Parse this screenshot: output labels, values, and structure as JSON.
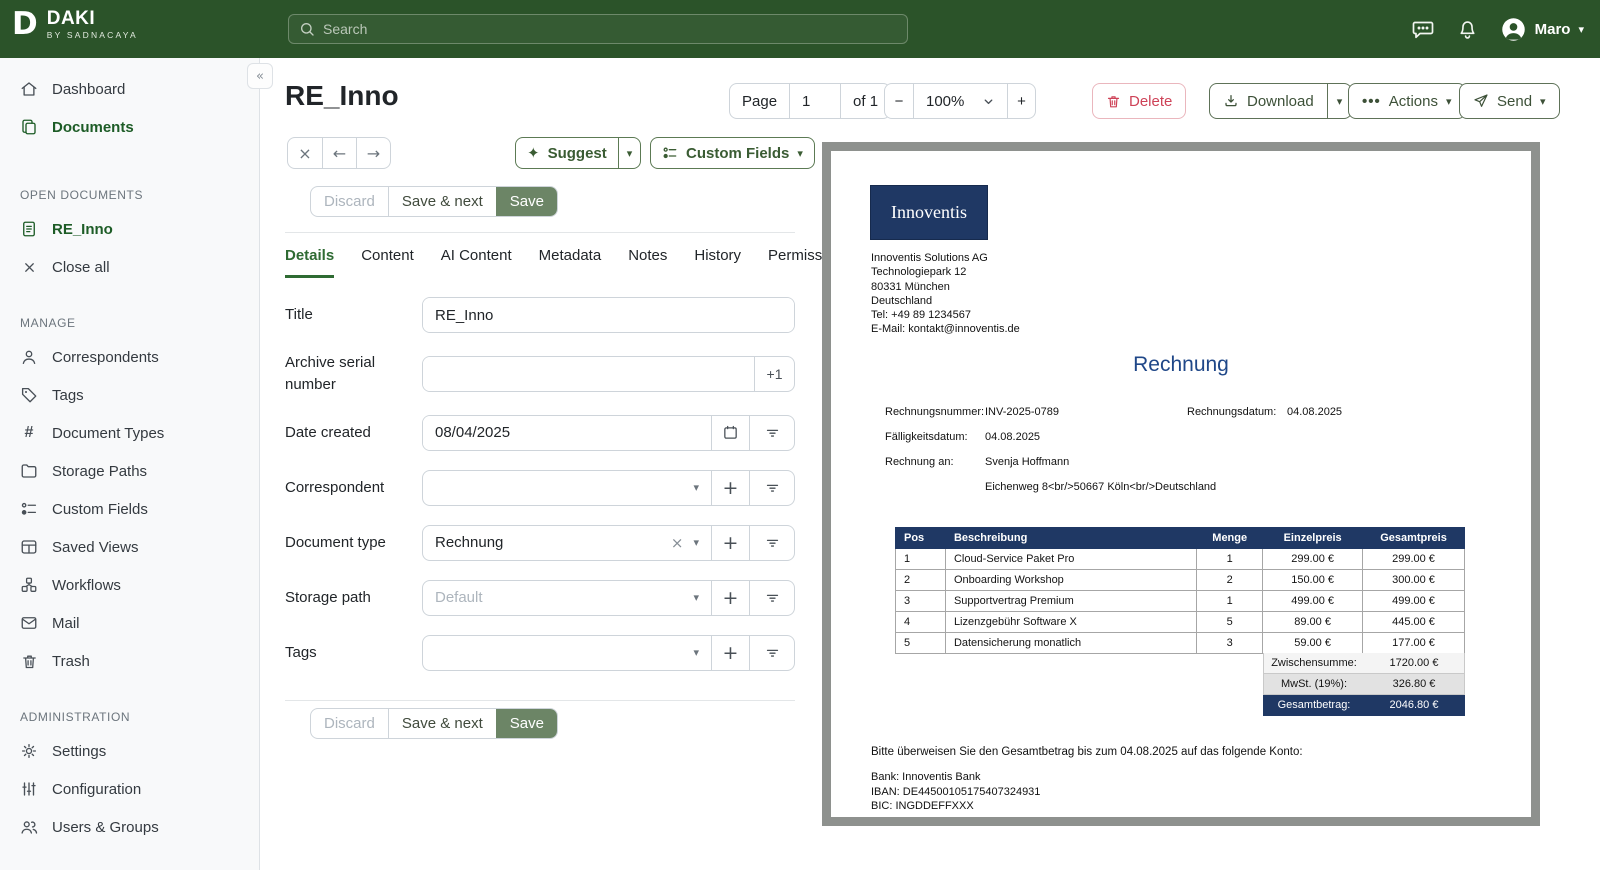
{
  "colors": {
    "header_green": "#2b5329",
    "accent_green": "#1d5c26",
    "button_green": "#3d5138",
    "save_fill_green": "#6c8566",
    "delete_red": "#ce4257",
    "invoice_navy": "#1f3864",
    "invoice_blue": "#1f4788"
  },
  "icons": {
    "collapse": "«",
    "close": "×",
    "arrow_left": "←",
    "arrow_right": "→",
    "sparkle": "✦",
    "ellipsis": "•••",
    "plus": "+",
    "minus": "−",
    "caret": "▾",
    "clear": "×"
  },
  "header": {
    "brand": "DAKI",
    "brand_sub": "BY SADNACAYA",
    "search_placeholder": "Search",
    "user_name": "Maro"
  },
  "sidebar": {
    "dashboard": "Dashboard",
    "documents": "Documents",
    "open_documents_header": "OPEN DOCUMENTS",
    "open_doc_name": "RE_Inno",
    "close_all": "Close all",
    "manage_header": "MANAGE",
    "manage": [
      "Correspondents",
      "Tags",
      "Document Types",
      "Storage Paths",
      "Custom Fields",
      "Saved Views",
      "Workflows",
      "Mail",
      "Trash"
    ],
    "admin_header": "ADMINISTRATION",
    "admin": [
      "Settings",
      "Configuration",
      "Users & Groups"
    ]
  },
  "toolbar": {
    "title": "RE_Inno",
    "page_label": "Page",
    "page_value": "1",
    "page_of": "of 1",
    "zoom_value": "100%",
    "delete": "Delete",
    "download": "Download",
    "actions": "Actions",
    "send": "Send"
  },
  "editor": {
    "suggest": "Suggest",
    "custom_fields": "Custom Fields",
    "discard": "Discard",
    "save_next": "Save & next",
    "save": "Save",
    "tabs": [
      "Details",
      "Content",
      "AI Content",
      "Metadata",
      "Notes",
      "History",
      "Permissions"
    ],
    "fields": {
      "title": {
        "label": "Title",
        "value": "RE_Inno"
      },
      "asn": {
        "label": "Archive serial number",
        "value": "",
        "increment": "+1"
      },
      "date_created": {
        "label": "Date created",
        "value": "08/04/2025"
      },
      "correspondent": {
        "label": "Correspondent",
        "value": ""
      },
      "document_type": {
        "label": "Document type",
        "value": "Rechnung"
      },
      "storage_path": {
        "label": "Storage path",
        "placeholder": "Default"
      },
      "tags": {
        "label": "Tags",
        "value": ""
      }
    }
  },
  "invoice": {
    "logo_text": "Innoventis",
    "company_lines": [
      "Innoventis Solutions AG",
      "Technologiepark 12",
      "80331 München",
      "Deutschland",
      "Tel: +49 89 1234567",
      "E-Mail: kontakt@innoventis.de"
    ],
    "title": "Rechnung",
    "meta": {
      "invoice_no_label": "Rechnungsnummer:",
      "invoice_no": "INV-2025-0789",
      "invoice_date_label": "Rechnungsdatum:",
      "invoice_date": "04.08.2025",
      "due_date_label": "Fälligkeitsdatum:",
      "due_date": "04.08.2025",
      "bill_to_label": "Rechnung an:",
      "bill_to_name": "Svenja Hoffmann",
      "bill_to_address": "Eichenweg 8<br/>50667 Köln<br/>Deutschland"
    },
    "table": {
      "headers": [
        "Pos",
        "Beschreibung",
        "Menge",
        "Einzelpreis",
        "Gesamtpreis"
      ],
      "rows": [
        [
          "1",
          "Cloud-Service Paket Pro",
          "1",
          "299.00 €",
          "299.00 €"
        ],
        [
          "2",
          "Onboarding Workshop",
          "2",
          "150.00 €",
          "300.00 €"
        ],
        [
          "3",
          "Supportvertrag Premium",
          "1",
          "499.00 €",
          "499.00 €"
        ],
        [
          "4",
          "Lizenzgebühr Software X",
          "5",
          "89.00 €",
          "445.00 €"
        ],
        [
          "5",
          "Datensicherung monatlich",
          "3",
          "59.00 €",
          "177.00 €"
        ]
      ],
      "totals": [
        {
          "label": "Zwischensumme:",
          "value": "1720.00 €"
        },
        {
          "label": "MwSt. (19%):",
          "value": "326.80 €"
        },
        {
          "label": "Gesamtbetrag:",
          "value": "2046.80 €"
        }
      ]
    },
    "footer_note": "Bitte überweisen Sie den Gesamtbetrag bis zum 04.08.2025 auf das folgende Konto:",
    "bank_lines": [
      "Bank: Innoventis Bank",
      "IBAN: DE44500105175407324931",
      "BIC: INGDDEFFXXX"
    ]
  }
}
